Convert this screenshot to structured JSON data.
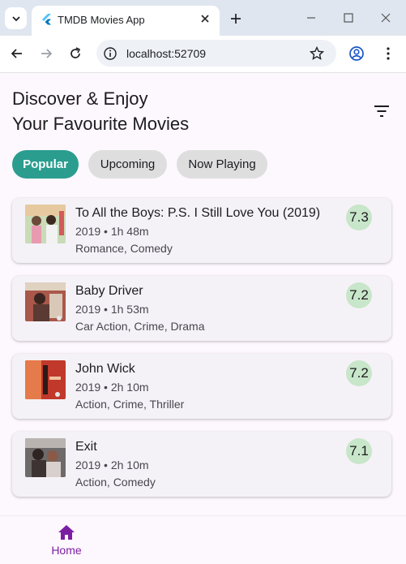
{
  "browser": {
    "tab_title": "TMDB Movies App",
    "url": "localhost:52709"
  },
  "app": {
    "headline_line1": "Discover & Enjoy",
    "headline_line2": "Your Favourite Movies",
    "chips": [
      {
        "label": "Popular",
        "active": true
      },
      {
        "label": "Upcoming",
        "active": false
      },
      {
        "label": "Now Playing",
        "active": false
      }
    ],
    "movies": [
      {
        "title": "To All the Boys: P.S. I Still Love You (2019)",
        "meta": "2019 • 1h 48m",
        "genres": "Romance, Comedy",
        "rating": "7.3"
      },
      {
        "title": "Baby Driver",
        "meta": "2019 • 1h 53m",
        "genres": "Car Action, Crime, Drama",
        "rating": "7.2"
      },
      {
        "title": "John Wick",
        "meta": "2019 • 2h 10m",
        "genres": "Action, Crime, Thriller",
        "rating": "7.2"
      },
      {
        "title": "Exit",
        "meta": "2019 • 2h 10m",
        "genres": "Action, Comedy",
        "rating": "7.1"
      }
    ],
    "bottom_nav": {
      "home_label": "Home"
    }
  },
  "colors": {
    "accent": "#2a9d8f",
    "rating_bg": "#c8e6c9",
    "nav_active": "#7b1fa2"
  },
  "icons": [
    "chevron-down-icon",
    "flutter-icon",
    "close-icon",
    "plus-icon",
    "minimize-icon",
    "maximize-icon",
    "back-icon",
    "forward-icon",
    "reload-icon",
    "info-icon",
    "star-icon",
    "profile-icon",
    "more-vert-icon",
    "filter-icon",
    "home-icon"
  ]
}
